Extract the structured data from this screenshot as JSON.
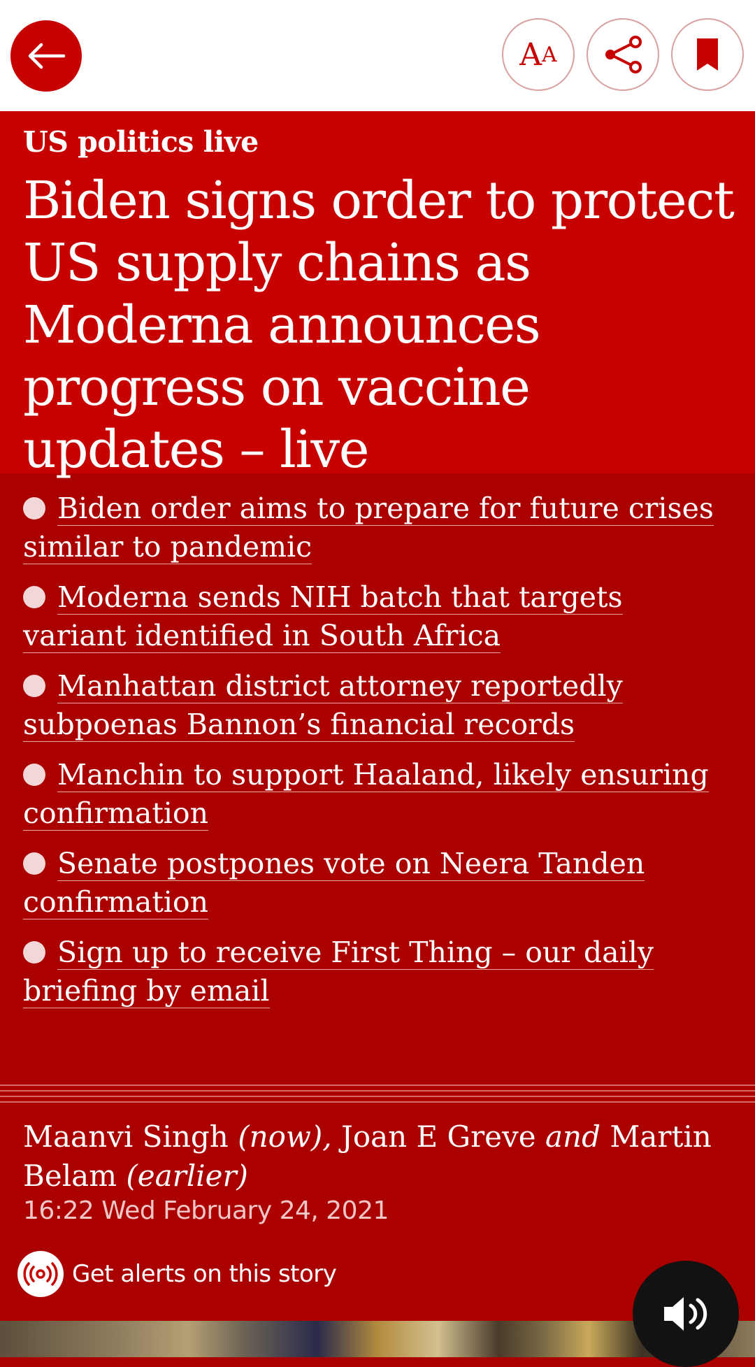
{
  "toolbar": {
    "back_icon": "arrow-left-icon",
    "text_size_big": "A",
    "text_size_small": "A",
    "share_icon": "share-icon",
    "save_icon": "bookmark-icon"
  },
  "article": {
    "kicker": "US politics live",
    "headline": "Biden signs order to protect US supply chains as Moderna announces progress on vaccine updates – live",
    "bullets": [
      {
        "text": "Biden order aims to prepare for future crises similar to pandemic"
      },
      {
        "text": "Moderna sends NIH batch that targets variant identified in South Africa"
      },
      {
        "text": "Manhattan district attorney reportedly subpoenas Bannon’s financial records"
      },
      {
        "text": "Manchin to support Haaland, likely ensuring confirmation"
      },
      {
        "text": "Senate postpones vote on Neera Tanden confirmation"
      },
      {
        "text": "Sign up to receive First Thing – our daily briefing by email"
      }
    ]
  },
  "byline": {
    "author1": "Maanvi Singh",
    "author1_note": "(now),",
    "author2": "Joan E Greve",
    "conjunction": "and",
    "author3": "Martin Belam",
    "author3_note": "(earlier)",
    "timestamp": "16:22 Wed February 24, 2021"
  },
  "alerts": {
    "label": "Get alerts on this story",
    "icon": "broadcast-icon"
  },
  "audio": {
    "icon": "speaker-icon"
  },
  "colors": {
    "header_red": "#c70000",
    "body_red": "#ab0000",
    "white": "#ffffff"
  }
}
